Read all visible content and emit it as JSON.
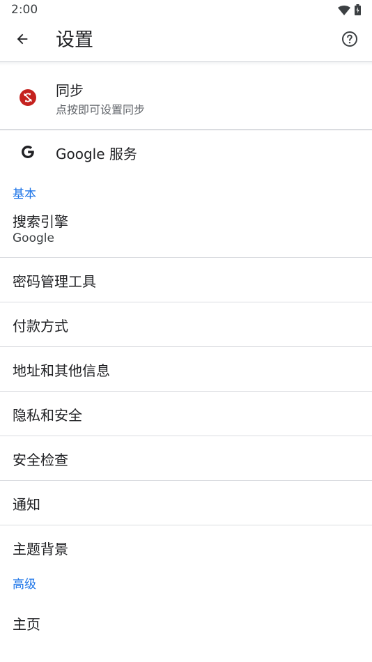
{
  "status_bar": {
    "time": "2:00",
    "icons": [
      "wifi-icon",
      "battery-icon"
    ]
  },
  "app_bar": {
    "title": "设置",
    "back_icon": "arrow-back-icon",
    "help_icon": "help-icon"
  },
  "sync": {
    "title": "同步",
    "subtitle": "点按即可设置同步",
    "icon": "sync-off-icon",
    "icon_color": "#c5221f"
  },
  "google_services": {
    "title": "Google 服务",
    "icon": "google-g-icon"
  },
  "sections": {
    "basic": "基本",
    "advanced": "高级"
  },
  "items": {
    "search_engine": {
      "title": "搜索引擎",
      "value": "Google"
    },
    "password_manager": {
      "title": "密码管理工具"
    },
    "payment_methods": {
      "title": "付款方式"
    },
    "addresses": {
      "title": "地址和其他信息"
    },
    "privacy": {
      "title": "隐私和安全"
    },
    "safety_check": {
      "title": "安全检查"
    },
    "notifications": {
      "title": "通知"
    },
    "theme": {
      "title": "主题背景"
    },
    "homepage": {
      "title": "主页"
    }
  },
  "colors": {
    "accent": "#1a73e8",
    "divider": "#dadce0",
    "text_primary": "#202124",
    "text_secondary": "#5f6368"
  }
}
